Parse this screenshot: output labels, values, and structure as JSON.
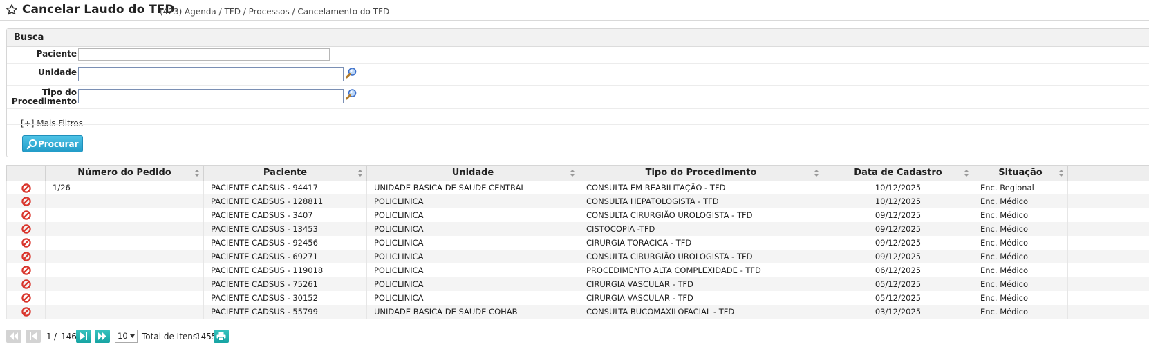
{
  "header": {
    "title": "Cancelar Laudo do TFD",
    "count": "(423)",
    "breadcrumb": "Agenda / TFD / Processos / Cancelamento do TFD"
  },
  "search": {
    "title": "Busca",
    "fields": {
      "paciente": {
        "label": "Paciente",
        "value": ""
      },
      "unidade": {
        "label": "Unidade",
        "value": ""
      },
      "tipo_procedimento": {
        "label_line1": "Tipo do",
        "label_line2": "Procedimento",
        "value": ""
      }
    },
    "more_filters": "[+] Mais Filtros",
    "search_button": "Procurar"
  },
  "table": {
    "columns": [
      "Número do Pedido",
      "Paciente",
      "Unidade",
      "Tipo do Procedimento",
      "Data de Cadastro",
      "Situação"
    ],
    "rows": [
      {
        "numero": "1/26",
        "paciente": "PACIENTE CADSUS - 94417",
        "unidade": "UNIDADE BASICA DE SAUDE CENTRAL",
        "tipo": "CONSULTA EM REABILITAÇÃO - TFD",
        "data": "10/12/2025",
        "situacao": "Enc. Regional"
      },
      {
        "numero": "",
        "paciente": "PACIENTE CADSUS - 128811",
        "unidade": "POLICLINICA",
        "tipo": "CONSULTA HEPATOLOGISTA - TFD",
        "data": "10/12/2025",
        "situacao": "Enc. Médico"
      },
      {
        "numero": "",
        "paciente": "PACIENTE CADSUS - 3407",
        "unidade": "POLICLINICA",
        "tipo": "CONSULTA CIRURGIÃO UROLOGISTA - TFD",
        "data": "09/12/2025",
        "situacao": "Enc. Médico"
      },
      {
        "numero": "",
        "paciente": "PACIENTE CADSUS - 13453",
        "unidade": "POLICLINICA",
        "tipo": "CISTOCOPIA -TFD",
        "data": "09/12/2025",
        "situacao": "Enc. Médico"
      },
      {
        "numero": "",
        "paciente": "PACIENTE CADSUS - 92456",
        "unidade": "POLICLINICA",
        "tipo": "CIRURGIA TORACICA - TFD",
        "data": "09/12/2025",
        "situacao": "Enc. Médico"
      },
      {
        "numero": "",
        "paciente": "PACIENTE CADSUS - 69271",
        "unidade": "POLICLINICA",
        "tipo": "CONSULTA CIRURGIÃO UROLOGISTA - TFD",
        "data": "09/12/2025",
        "situacao": "Enc. Médico"
      },
      {
        "numero": "",
        "paciente": "PACIENTE CADSUS - 119018",
        "unidade": "POLICLINICA",
        "tipo": "PROCEDIMENTO ALTA COMPLEXIDADE - TFD",
        "data": "06/12/2025",
        "situacao": "Enc. Médico"
      },
      {
        "numero": "",
        "paciente": "PACIENTE CADSUS - 75261",
        "unidade": "POLICLINICA",
        "tipo": "CIRURGIA VASCULAR - TFD",
        "data": "05/12/2025",
        "situacao": "Enc. Médico"
      },
      {
        "numero": "",
        "paciente": "PACIENTE CADSUS - 30152",
        "unidade": "POLICLINICA",
        "tipo": "CIRURGIA VASCULAR - TFD",
        "data": "05/12/2025",
        "situacao": "Enc. Médico"
      },
      {
        "numero": "",
        "paciente": "PACIENTE CADSUS - 55799",
        "unidade": "UNIDADE BASICA DE SAUDE COHAB",
        "tipo": "CONSULTA BUCOMAXILOFACIAL - TFD",
        "data": "03/12/2025",
        "situacao": "Enc. Médico"
      }
    ]
  },
  "pager": {
    "current_page": "1",
    "separator": "/",
    "total_pages": "146",
    "page_size": "10",
    "total_label": "Total de Itens:",
    "total_items": "1455"
  },
  "icons": {
    "title": "star-outline-icon",
    "lookup": "magnifier-lookup-icon",
    "row_action": "cancel-prohibited-icon",
    "print": "printer-icon"
  },
  "colors": {
    "search_button": "#229cc8",
    "pager_active": "#17a4a3",
    "cancel_icon": "#d9342b",
    "lookup_icon": "#3d6fc9"
  }
}
